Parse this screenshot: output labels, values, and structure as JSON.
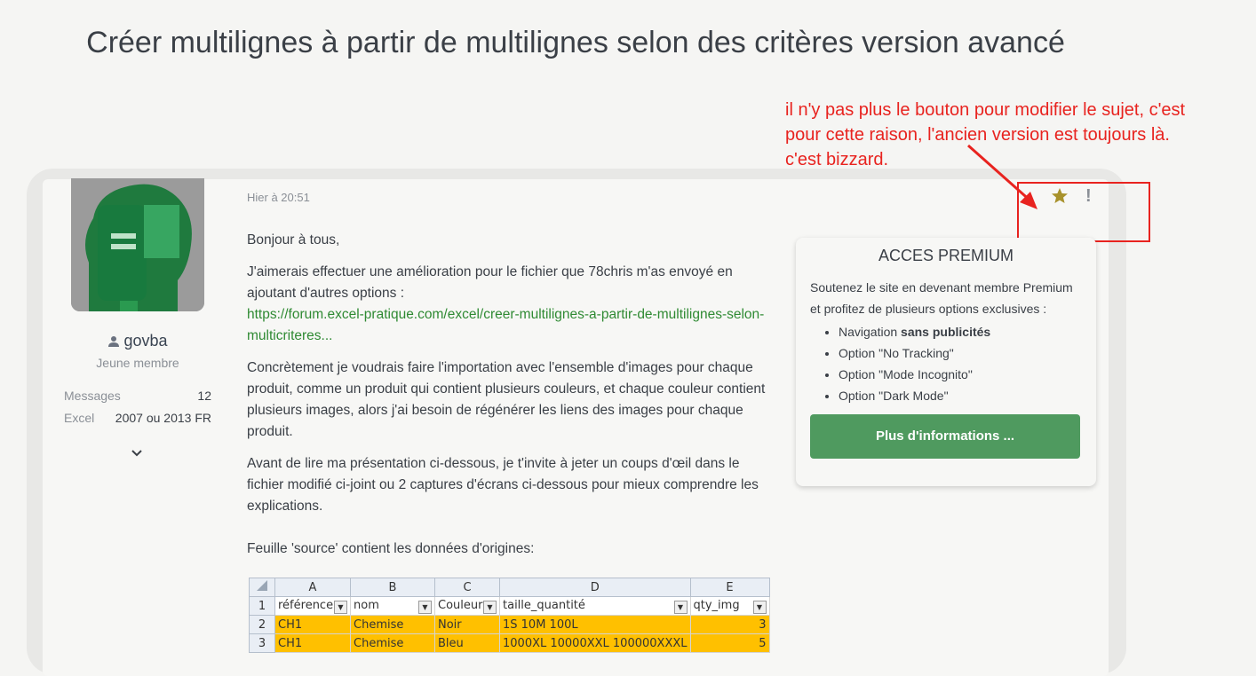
{
  "page": {
    "title": "Créer multilignes à partir de multilignes selon des critères version avancé"
  },
  "annotation": {
    "text_line1": "il n'y pas plus le bouton pour modifier le sujet, c'est",
    "text_line2": "pour cette raison, l'ancien version est toujours là.",
    "text_line3": "c'est bizzard."
  },
  "author": {
    "username": "govba",
    "role": "Jeune membre",
    "stats": [
      {
        "label": "Messages",
        "value": "12"
      },
      {
        "label": "Excel",
        "value": "2007 ou 2013 FR"
      }
    ]
  },
  "post": {
    "time": "Hier à 20:51",
    "greeting": "Bonjour à tous,",
    "para1": "J'aimerais effectuer une amélioration pour le fichier que 78chris m'as envoyé en ajoutant d'autres options :",
    "link": "https://forum.excel-pratique.com/excel/creer-multilignes-a-partir-de-multilignes-selon-multicriteres...",
    "para2": "Concrètement je voudrais faire l'importation avec l'ensemble d'images pour chaque produit, comme un produit qui contient plusieurs couleurs, et chaque couleur contient plusieurs images, alors j'ai besoin de régénérer les liens des images pour chaque produit.",
    "para3": "Avant de lire ma présentation ci-dessous, je t'invite à jeter un coups d'œil dans le fichier modifié ci-joint ou 2 captures d'écrans ci-dessous pour mieux comprendre les explications.",
    "para4": "Feuille 'source' contient les données d'origines:"
  },
  "premium": {
    "title": "ACCES PREMIUM",
    "text": "Soutenez le site en devenant membre Premium et profitez de plusieurs options exclusives :",
    "item1_prefix": "Navigation ",
    "item1_bold": "sans publicités",
    "item2": "Option \"No Tracking\"",
    "item3": "Option \"Mode Incognito\"",
    "item4": "Option \"Dark Mode\"",
    "button": "Plus d'informations ..."
  },
  "sheet": {
    "columns": [
      "A",
      "B",
      "C",
      "D",
      "E"
    ],
    "headers": [
      "référence",
      "nom",
      "Couleur",
      "taille_quantité",
      "qty_img"
    ],
    "rows": [
      {
        "n": "1"
      },
      {
        "n": "2",
        "cells": [
          "CH1",
          "Chemise",
          "Noir",
          "1S 10M 100L",
          "3"
        ]
      },
      {
        "n": "3",
        "cells": [
          "CH1",
          "Chemise",
          "Bleu",
          "1000XL 10000XXL 100000XXXL",
          "5"
        ]
      }
    ]
  },
  "colors": {
    "accent_green": "#4f9a5f",
    "annotation_red": "#e8231f",
    "highlight_yellow": "#ffc000"
  }
}
